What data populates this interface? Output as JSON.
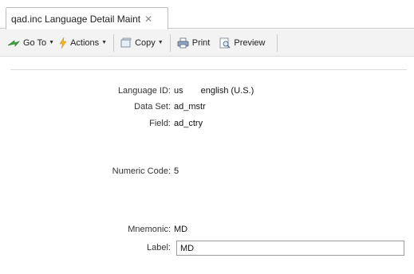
{
  "tab": {
    "title": "qad.inc Language Detail Maint",
    "close_glyph": "✕"
  },
  "toolbar": {
    "goto": "Go To",
    "actions": "Actions",
    "copy": "Copy",
    "print": "Print",
    "preview": "Preview"
  },
  "form": {
    "language_id_label": "Language ID:",
    "language_id_value": "us",
    "language_name": "english (U.S.)",
    "dataset_label": "Data Set:",
    "dataset_value": "ad_mstr",
    "field_label": "Field:",
    "field_value": "ad_ctry",
    "numeric_code_label": "Numeric Code:",
    "numeric_code_value": "5",
    "mnemonic_label": "Mnemonic:",
    "mnemonic_value": "MD",
    "label_label": "Label:",
    "label_value": "MD"
  }
}
